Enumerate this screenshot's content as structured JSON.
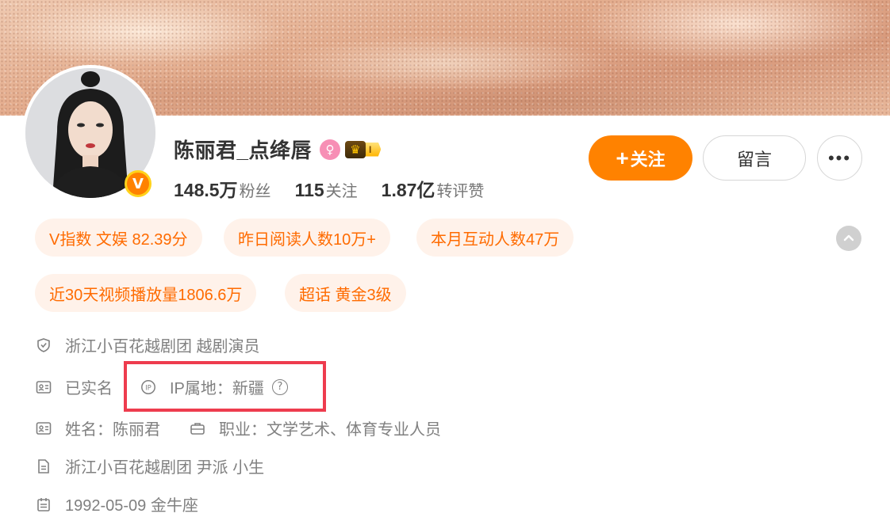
{
  "profile": {
    "name": "陈丽君_点绛唇",
    "gender_symbol": "♀",
    "level_label": "I",
    "verify_badge": "V",
    "stats": [
      {
        "num": "148.5万",
        "label": "粉丝"
      },
      {
        "num": "115",
        "label": "关注"
      },
      {
        "num": "1.87亿",
        "label": "转评赞"
      }
    ]
  },
  "actions": {
    "follow_plus": "+",
    "follow_label": "关注",
    "message_label": "留言",
    "more_label": "•••"
  },
  "tags": [
    "V指数 文娱 82.39分",
    "昨日阅读人数10万+",
    "本月互动人数47万",
    "近30天视频播放量1806.6万",
    "超话 黄金3级"
  ],
  "info": {
    "organization": "浙江小百花越剧团 越剧演员",
    "real_name_status": "已实名",
    "ip_location": "IP属地：新疆",
    "ip_help": "?",
    "full_name": "姓名：陈丽君",
    "occupation": "职业：文学艺术、体育专业人员",
    "bio": "浙江小百花越剧团 尹派 小生",
    "birthday": "1992-05-09 金牛座"
  },
  "colors": {
    "accent": "#ff8200",
    "tag_bg": "#fff2ea",
    "tag_text": "#ff6b00",
    "highlight": "#ee3c4e"
  },
  "icons": [
    "shield-icon",
    "id-card-icon",
    "ip-icon",
    "help-icon",
    "briefcase-icon",
    "document-icon",
    "calendar-icon",
    "chevron-up-icon",
    "crown-icon",
    "female-icon"
  ]
}
